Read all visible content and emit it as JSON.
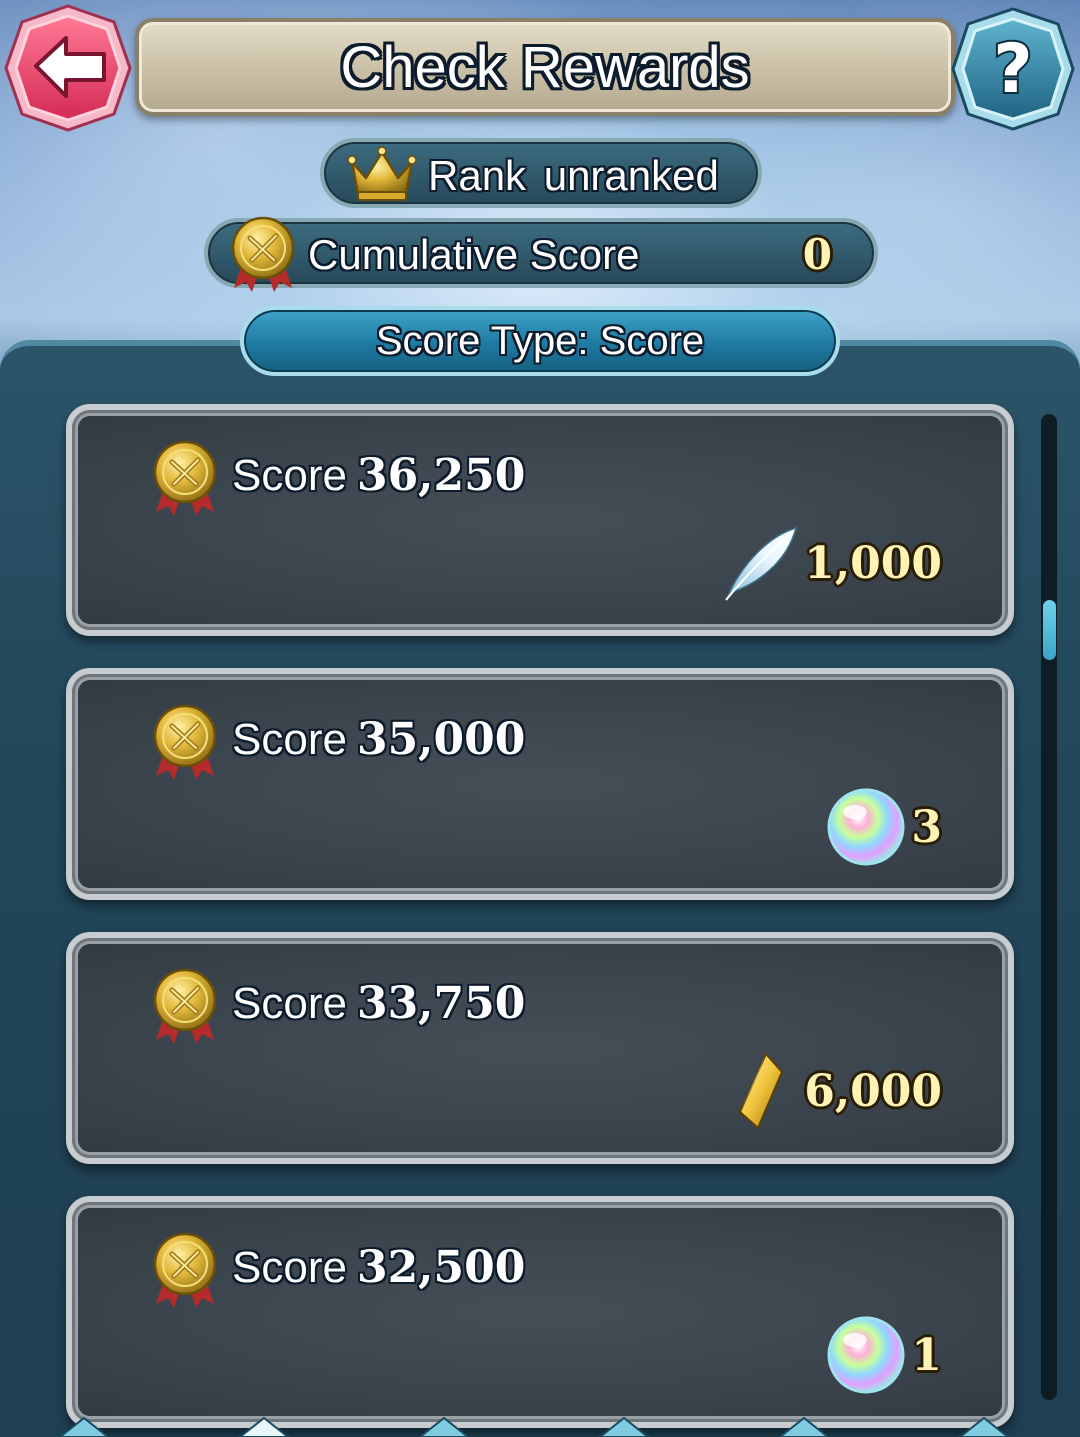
{
  "header": {
    "title": "Check Rewards",
    "back_icon": "back-arrow-icon",
    "help_label": "?"
  },
  "rank": {
    "label": "Rank  unranked",
    "icon": "crown-icon"
  },
  "cumulative": {
    "label": "Cumulative Score",
    "value": "0",
    "icon": "medal-icon"
  },
  "score_type": {
    "label": "Score Type: Score"
  },
  "rewards": [
    {
      "label": "Score",
      "score": "36,250",
      "reward_icon": "feather-icon",
      "quantity": "1,000"
    },
    {
      "label": "Score",
      "score": "35,000",
      "reward_icon": "orb-icon",
      "quantity": "3"
    },
    {
      "label": "Score",
      "score": "33,750",
      "reward_icon": "crystal-icon",
      "quantity": "6,000"
    },
    {
      "label": "Score",
      "score": "32,500",
      "reward_icon": "orb-icon",
      "quantity": "1"
    }
  ],
  "colors": {
    "accent": "#3fa3c6",
    "gold": "#fff3b5",
    "back_button": "#e8476a"
  }
}
